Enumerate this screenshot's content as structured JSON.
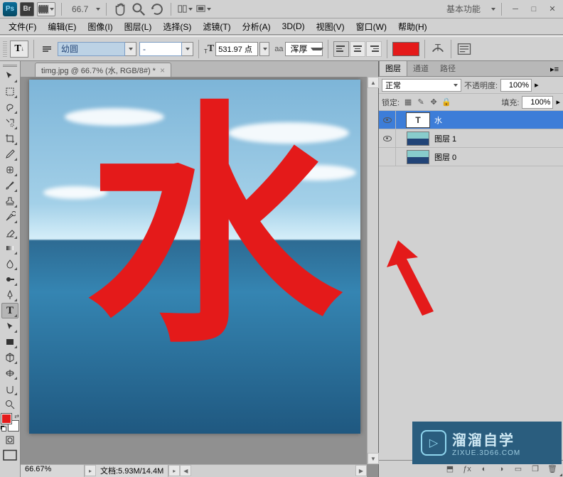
{
  "app": {
    "zoom_display": "66.7",
    "workspace": "基本功能"
  },
  "menu": {
    "file": "文件(F)",
    "edit": "编辑(E)",
    "image": "图像(I)",
    "layer": "图层(L)",
    "select": "选择(S)",
    "filter": "滤镜(T)",
    "analysis": "分析(A)",
    "threed": "3D(D)",
    "view": "视图(V)",
    "window": "窗口(W)",
    "help": "帮助(H)"
  },
  "options": {
    "font_family": "幼圆",
    "font_style": "-",
    "font_size": "531.97 点",
    "aa_label": "aa",
    "aa_value": "浑厚",
    "text_color": "#e41a1a"
  },
  "doc": {
    "tab_title": "timg.jpg @ 66.7% (水, RGB/8#) *",
    "canvas_text": "水"
  },
  "status": {
    "zoom": "66.67%",
    "doc_info": "文档:5.93M/14.4M"
  },
  "panels": {
    "layers_tab": "图层",
    "channels_tab": "通道",
    "paths_tab": "路径",
    "blend_mode": "正常",
    "opacity_label": "不透明度:",
    "opacity_value": "100%",
    "lock_label": "锁定:",
    "fill_label": "填充:",
    "fill_value": "100%",
    "layers": [
      {
        "name": "水",
        "type": "text",
        "visible": true,
        "selected": true
      },
      {
        "name": "图层 1",
        "type": "image",
        "visible": true,
        "selected": false
      },
      {
        "name": "图层 0",
        "type": "image",
        "visible": false,
        "selected": false
      }
    ]
  },
  "watermark": {
    "cn": "溜溜自学",
    "en": "ZIXUE.3D66.COM"
  }
}
